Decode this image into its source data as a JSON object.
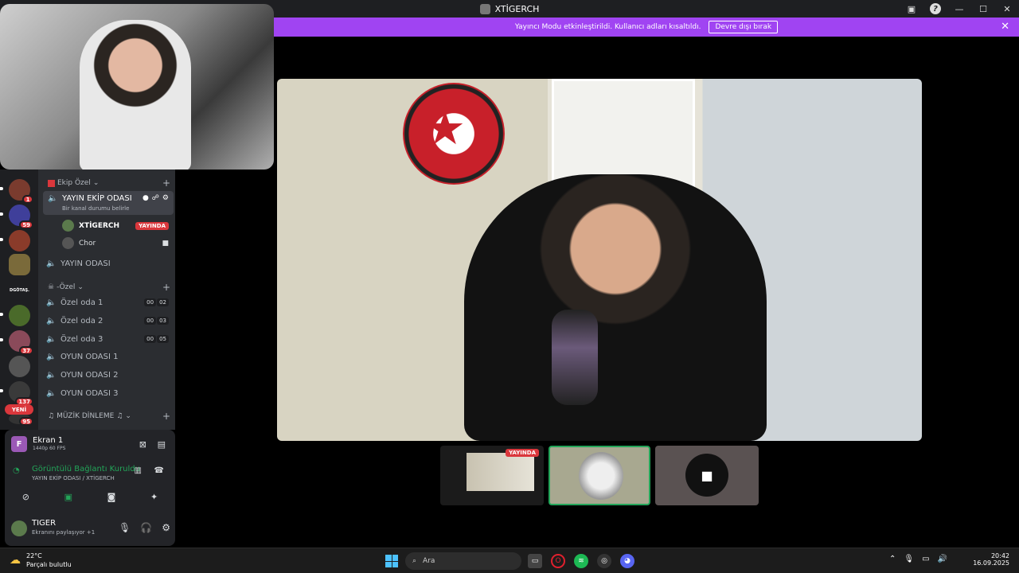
{
  "window": {
    "title": "XTİGERCH"
  },
  "banner": {
    "text": "Yayıncı Modu etkinleştirildi. Kullanıcı adları kısaltıldı.",
    "button": "Devre dışı bırak"
  },
  "servers": {
    "items": [
      {
        "label": "",
        "badge": "1",
        "color": "#7a3b2e"
      },
      {
        "label": "",
        "badge": "59",
        "color": "#3f3f9a"
      },
      {
        "label": "",
        "badge": "",
        "color": "#8a3b2a"
      },
      {
        "label": "",
        "badge": "",
        "color": "#7a6a3a"
      },
      {
        "label": "DGÖTAŞ.",
        "badge": "",
        "color": "#1e1f22"
      },
      {
        "label": "",
        "badge": "",
        "color": "#4a6a2a"
      },
      {
        "label": "",
        "badge": "37",
        "color": "#8a4a5a"
      },
      {
        "label": "",
        "badge": "",
        "color": "#555"
      },
      {
        "label": "",
        "badge": "137",
        "color": "#3a3a3a"
      }
    ],
    "new_badge": "YENİ",
    "last_badge": "95"
  },
  "channels": {
    "category1": "Ekip Özel",
    "active_channel": {
      "name": "YAYIN EKİP ODASI",
      "status": "Bir kanal durumu belirle"
    },
    "users": [
      {
        "name": "XTİGERCH",
        "live": "YAYINDA"
      },
      {
        "name": "Chor",
        "live": ""
      }
    ],
    "yayin_odasi": "YAYIN ODASI",
    "category2": "-Özel",
    "voice": [
      {
        "name": "Özel oda 1",
        "a": "00",
        "b": "02"
      },
      {
        "name": "Özel oda 2",
        "a": "00",
        "b": "03"
      },
      {
        "name": "Özel oda 3",
        "a": "00",
        "b": "05"
      },
      {
        "name": "OYUN ODASI 1",
        "a": "",
        "b": ""
      },
      {
        "name": "OYUN ODASI 2",
        "a": "",
        "b": ""
      },
      {
        "name": "OYUN ODASI 3",
        "a": "",
        "b": ""
      }
    ],
    "category3": "MÜZİK DİNLEME"
  },
  "stream_panel": {
    "screen_title": "Ekran 1",
    "screen_quality": "1440p 60 FPS",
    "connection": "Görüntülü Bağlantı Kuruldu",
    "connection_sub": "YAYIN EKİP ODASI / XTİGERCH"
  },
  "user_panel": {
    "name": "TIGER",
    "status": "Ekranını paylaşıyor +1"
  },
  "thumbs": {
    "live": "YAYINDA"
  },
  "taskbar": {
    "temp": "22°C",
    "weather": "Parçalı bulutlu",
    "search_placeholder": "Ara",
    "time": "20:42",
    "date": "16.09.2025"
  }
}
